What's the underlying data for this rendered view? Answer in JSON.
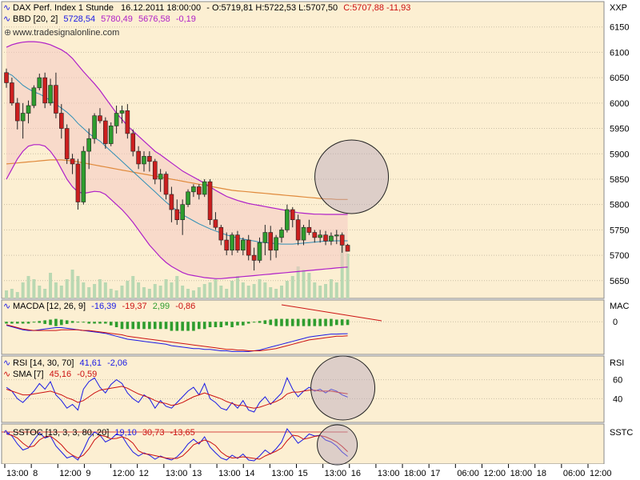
{
  "colors": {
    "background": "#fcefd2",
    "up": "#2e9d2e",
    "down": "#cc1f1f",
    "band": "#f4c9c2",
    "band_line": "#b020c8",
    "volume": "#b9d8b2",
    "macd": "#1a1ae6",
    "signal": "#cc1111",
    "rsi": "#1a1ae6",
    "sma": "#cc1111",
    "circle": "#b7a6bd"
  },
  "chart_data": [
    {
      "type": "candlestick",
      "panel": "price",
      "title_line": {
        "name": "DAX Perf. Index 1 Stunde",
        "stamp": "16.12.2011 18:00:00",
        "ohl": "- O:5719,81 H:5722,53 L:5707,50",
        "close": "C:5707,88 -11,93"
      },
      "indicator_line": {
        "name": "BBD [20, 2]",
        "v1": "5728,54",
        "v2": "5780,49",
        "v3": "5676,58",
        "v4": "-0,19"
      },
      "watermark": "www.tradesignalonline.com",
      "unit_label": "XXP",
      "ylim": [
        5615,
        6200
      ],
      "y_ticks": [
        "6150",
        "6100",
        "6050",
        "6000",
        "5950",
        "5900",
        "5850",
        "5800",
        "5750",
        "5700",
        "5650"
      ],
      "candles": [
        {
          "o": 6060,
          "h": 6068,
          "l": 6030,
          "c": 6040
        },
        {
          "o": 6040,
          "h": 6050,
          "l": 5995,
          "c": 6000
        },
        {
          "o": 6000,
          "h": 6010,
          "l": 5948,
          "c": 5965
        },
        {
          "o": 5965,
          "h": 6000,
          "l": 5930,
          "c": 5980
        },
        {
          "o": 5980,
          "h": 6005,
          "l": 5960,
          "c": 5995
        },
        {
          "o": 5995,
          "h": 6035,
          "l": 5990,
          "c": 6030
        },
        {
          "o": 6030,
          "h": 6058,
          "l": 6025,
          "c": 6050
        },
        {
          "o": 6050,
          "h": 6060,
          "l": 5990,
          "c": 6000
        },
        {
          "o": 6000,
          "h": 6048,
          "l": 5995,
          "c": 6035
        },
        {
          "o": 6035,
          "h": 6060,
          "l": 5970,
          "c": 5980
        },
        {
          "o": 5980,
          "h": 5998,
          "l": 5930,
          "c": 5950
        },
        {
          "o": 5950,
          "h": 5958,
          "l": 5880,
          "c": 5890
        },
        {
          "o": 5890,
          "h": 5900,
          "l": 5860,
          "c": 5880
        },
        {
          "o": 5880,
          "h": 5890,
          "l": 5790,
          "c": 5805
        },
        {
          "o": 5805,
          "h": 5915,
          "l": 5800,
          "c": 5905
        },
        {
          "o": 5905,
          "h": 5950,
          "l": 5870,
          "c": 5930
        },
        {
          "o": 5930,
          "h": 5980,
          "l": 5920,
          "c": 5975
        },
        {
          "o": 5975,
          "h": 5990,
          "l": 5960,
          "c": 5965
        },
        {
          "o": 5965,
          "h": 5972,
          "l": 5910,
          "c": 5920
        },
        {
          "o": 5920,
          "h": 5962,
          "l": 5915,
          "c": 5955
        },
        {
          "o": 5955,
          "h": 5995,
          "l": 5940,
          "c": 5980
        },
        {
          "o": 5980,
          "h": 5995,
          "l": 5960,
          "c": 5985
        },
        {
          "o": 5985,
          "h": 5998,
          "l": 5930,
          "c": 5940
        },
        {
          "o": 5940,
          "h": 5948,
          "l": 5895,
          "c": 5905
        },
        {
          "o": 5905,
          "h": 5915,
          "l": 5870,
          "c": 5880
        },
        {
          "o": 5880,
          "h": 5905,
          "l": 5865,
          "c": 5895
        },
        {
          "o": 5895,
          "h": 5905,
          "l": 5865,
          "c": 5885
        },
        {
          "o": 5885,
          "h": 5890,
          "l": 5840,
          "c": 5850
        },
        {
          "o": 5850,
          "h": 5870,
          "l": 5825,
          "c": 5860
        },
        {
          "o": 5860,
          "h": 5865,
          "l": 5810,
          "c": 5820
        },
        {
          "o": 5820,
          "h": 5835,
          "l": 5765,
          "c": 5790
        },
        {
          "o": 5790,
          "h": 5810,
          "l": 5760,
          "c": 5770
        },
        {
          "o": 5770,
          "h": 5810,
          "l": 5740,
          "c": 5800
        },
        {
          "o": 5800,
          "h": 5830,
          "l": 5795,
          "c": 5825
        },
        {
          "o": 5825,
          "h": 5840,
          "l": 5815,
          "c": 5835
        },
        {
          "o": 5835,
          "h": 5840,
          "l": 5810,
          "c": 5820
        },
        {
          "o": 5820,
          "h": 5850,
          "l": 5815,
          "c": 5845
        },
        {
          "o": 5845,
          "h": 5850,
          "l": 5760,
          "c": 5770
        },
        {
          "o": 5770,
          "h": 5785,
          "l": 5750,
          "c": 5755
        },
        {
          "o": 5755,
          "h": 5760,
          "l": 5720,
          "c": 5730
        },
        {
          "o": 5730,
          "h": 5745,
          "l": 5700,
          "c": 5710
        },
        {
          "o": 5710,
          "h": 5745,
          "l": 5700,
          "c": 5740
        },
        {
          "o": 5740,
          "h": 5748,
          "l": 5705,
          "c": 5710
        },
        {
          "o": 5710,
          "h": 5735,
          "l": 5700,
          "c": 5730
        },
        {
          "o": 5730,
          "h": 5740,
          "l": 5690,
          "c": 5700
        },
        {
          "o": 5700,
          "h": 5715,
          "l": 5670,
          "c": 5690
        },
        {
          "o": 5690,
          "h": 5735,
          "l": 5685,
          "c": 5725
        },
        {
          "o": 5725,
          "h": 5760,
          "l": 5700,
          "c": 5745
        },
        {
          "o": 5745,
          "h": 5758,
          "l": 5690,
          "c": 5710
        },
        {
          "o": 5710,
          "h": 5740,
          "l": 5695,
          "c": 5735
        },
        {
          "o": 5735,
          "h": 5755,
          "l": 5725,
          "c": 5750
        },
        {
          "o": 5750,
          "h": 5800,
          "l": 5745,
          "c": 5790
        },
        {
          "o": 5790,
          "h": 5795,
          "l": 5755,
          "c": 5770
        },
        {
          "o": 5770,
          "h": 5780,
          "l": 5720,
          "c": 5730
        },
        {
          "o": 5730,
          "h": 5760,
          "l": 5720,
          "c": 5755
        },
        {
          "o": 5755,
          "h": 5770,
          "l": 5740,
          "c": 5745
        },
        {
          "o": 5745,
          "h": 5750,
          "l": 5725,
          "c": 5735
        },
        {
          "o": 5735,
          "h": 5750,
          "l": 5725,
          "c": 5740
        },
        {
          "o": 5740,
          "h": 5748,
          "l": 5720,
          "c": 5728
        },
        {
          "o": 5728,
          "h": 5745,
          "l": 5720,
          "c": 5738
        },
        {
          "o": 5738,
          "h": 5750,
          "l": 5722,
          "c": 5740
        },
        {
          "o": 5740,
          "h": 5745,
          "l": 5705,
          "c": 5720
        },
        {
          "o": 5719.81,
          "h": 5722.53,
          "l": 5707.5,
          "c": 5707.88
        }
      ],
      "volume": [
        5,
        6,
        4,
        10,
        14,
        12,
        8,
        6,
        16,
        10,
        8,
        12,
        18,
        14,
        10,
        7,
        9,
        12,
        10,
        6,
        5,
        8,
        11,
        14,
        10,
        7,
        6,
        9,
        8,
        12,
        10,
        14,
        8,
        6,
        5,
        7,
        9,
        10,
        12,
        8,
        6,
        11,
        14,
        10,
        8,
        9,
        12,
        10,
        7,
        6,
        8,
        11,
        14,
        20,
        18,
        16,
        10,
        8,
        9,
        12,
        10,
        40,
        28
      ],
      "upper_band": [
        6110,
        6115,
        6118,
        6120,
        6121,
        6121,
        6120,
        6118,
        6115,
        6110,
        6105,
        6098,
        6088,
        6075,
        6062,
        6050,
        6038,
        6025,
        6010,
        5995,
        5980,
        5968,
        5955,
        5945,
        5935,
        5925,
        5915,
        5905,
        5898,
        5890,
        5882,
        5874,
        5866,
        5860,
        5854,
        5848,
        5842,
        5835,
        5828,
        5822,
        5816,
        5812,
        5808,
        5805,
        5802,
        5800,
        5798,
        5796,
        5794,
        5792,
        5790,
        5788,
        5786,
        5784,
        5783,
        5782,
        5781,
        5781,
        5780.6,
        5780.5,
        5780.5,
        5780.5,
        5780.49
      ],
      "lower_band": [
        5850,
        5870,
        5890,
        5905,
        5915,
        5918,
        5918,
        5915,
        5905,
        5890,
        5870,
        5850,
        5835,
        5825,
        5822,
        5824,
        5826,
        5825,
        5820,
        5810,
        5800,
        5790,
        5778,
        5765,
        5750,
        5735,
        5720,
        5708,
        5696,
        5686,
        5678,
        5672,
        5666,
        5662,
        5660,
        5658,
        5656,
        5655,
        5654,
        5654,
        5655,
        5656,
        5657,
        5658,
        5659,
        5660,
        5661,
        5662,
        5663,
        5664,
        5665,
        5666,
        5667,
        5668,
        5669,
        5670,
        5671,
        5672,
        5673,
        5674,
        5675,
        5676,
        5676.58
      ],
      "mid_band": [
        6060,
        6055,
        6045,
        6035,
        6028,
        6022,
        6018,
        6012,
        6005,
        5998,
        5990,
        5982,
        5972,
        5960,
        5950,
        5940,
        5932,
        5925,
        5915,
        5905,
        5895,
        5885,
        5875,
        5865,
        5855,
        5845,
        5835,
        5825,
        5815,
        5805,
        5796,
        5788,
        5780,
        5774,
        5768,
        5762,
        5757,
        5752,
        5748,
        5744,
        5740,
        5737,
        5734,
        5732,
        5730,
        5728,
        5726,
        5725,
        5724,
        5723,
        5722,
        5722,
        5722,
        5723,
        5724,
        5725,
        5726,
        5727,
        5728,
        5728,
        5728.5,
        5728.5,
        5728.54
      ],
      "ma_long": [
        5880,
        5881,
        5882,
        5883,
        5884,
        5885,
        5886,
        5887,
        5888,
        5888,
        5888,
        5887,
        5886,
        5884,
        5882,
        5880,
        5878,
        5876,
        5874,
        5872,
        5870,
        5868,
        5866,
        5864,
        5862,
        5860,
        5858,
        5856,
        5854,
        5852,
        5850,
        5848,
        5846,
        5844,
        5842,
        5840,
        5838,
        5836,
        5834,
        5832,
        5830,
        5828,
        5827,
        5826,
        5825,
        5824,
        5823,
        5822,
        5821,
        5820,
        5819,
        5818,
        5817,
        5816,
        5815,
        5814,
        5813,
        5812,
        5811,
        5811,
        5810,
        5810,
        5810
      ]
    },
    {
      "type": "line",
      "panel": "macd",
      "name": "MACDA [12, 26, 9]",
      "values_text": [
        "-16,39",
        "-19,37",
        "2,99",
        "-0,86"
      ],
      "unit_label": "MAC",
      "ylim": [
        -45,
        30
      ],
      "y_ticks": [
        "0"
      ],
      "macd": [
        -5,
        -7,
        -9,
        -11,
        -12,
        -12,
        -11,
        -10,
        -9,
        -8,
        -8,
        -9,
        -10,
        -11,
        -12,
        -13,
        -14,
        -15,
        -16,
        -18,
        -20,
        -22,
        -24,
        -25,
        -26,
        -27,
        -28,
        -29,
        -30,
        -31,
        -33,
        -34,
        -35,
        -36,
        -37,
        -37,
        -38,
        -38,
        -39,
        -40,
        -40,
        -41,
        -41,
        -41,
        -41,
        -40,
        -39,
        -37,
        -35,
        -33,
        -31,
        -29,
        -27,
        -25,
        -23,
        -21,
        -20,
        -19,
        -18,
        -17,
        -17,
        -16.5,
        -16.39
      ],
      "signal": [
        -4,
        -6,
        -8,
        -10,
        -11,
        -12,
        -12,
        -12,
        -12,
        -12,
        -11,
        -11,
        -11,
        -11,
        -12,
        -12,
        -13,
        -14,
        -15,
        -16,
        -17,
        -18,
        -20,
        -21,
        -22,
        -23,
        -24,
        -25,
        -26,
        -27,
        -28,
        -29,
        -30,
        -31,
        -32,
        -33,
        -34,
        -35,
        -36,
        -37,
        -38,
        -38,
        -39,
        -39,
        -40,
        -40,
        -40,
        -39,
        -38,
        -37,
        -35,
        -33,
        -31,
        -29,
        -27,
        -25,
        -24,
        -23,
        -22,
        -21,
        -20,
        -19.8,
        -19.37
      ],
      "histogram": [
        -1,
        -1,
        -1,
        -1,
        -1,
        0,
        1,
        2,
        3,
        4,
        3,
        2,
        1,
        0,
        0,
        -1,
        -1,
        -1,
        -1,
        -2,
        -3,
        -4,
        -4,
        -4,
        -4,
        -4,
        -4,
        -4,
        -4,
        -4,
        -5,
        -5,
        -5,
        -5,
        -5,
        -4,
        -4,
        -3,
        -3,
        -3,
        -2,
        -3,
        -2,
        -2,
        -1,
        0,
        1,
        2,
        3,
        4,
        4,
        4,
        4,
        4,
        4,
        4,
        4,
        4,
        4,
        4,
        3,
        3.3,
        2.99
      ]
    },
    {
      "type": "line",
      "panel": "rsi",
      "series_labels": [
        "RSI [14, 30, 70]",
        "SMA [7]"
      ],
      "rsi_values_text": [
        "41,61",
        "-2,06"
      ],
      "sma_values_text": [
        "45,16",
        "-0,59"
      ],
      "unit_label": "RSI",
      "ylim": [
        15,
        85
      ],
      "y_ticks": [
        "60",
        "40"
      ],
      "rsi": [
        52,
        48,
        40,
        36,
        42,
        48,
        56,
        50,
        58,
        44,
        38,
        30,
        34,
        28,
        50,
        58,
        62,
        52,
        46,
        55,
        60,
        56,
        46,
        40,
        36,
        44,
        40,
        30,
        38,
        32,
        30,
        36,
        42,
        48,
        52,
        44,
        56,
        40,
        36,
        30,
        28,
        36,
        30,
        38,
        28,
        26,
        36,
        42,
        34,
        40,
        46,
        62,
        50,
        42,
        48,
        52,
        48,
        50,
        46,
        50,
        48,
        44,
        41.61
      ],
      "sma": [
        50,
        48,
        46,
        44,
        44,
        45,
        46,
        47,
        48,
        46,
        44,
        41,
        39,
        36,
        38,
        42,
        46,
        49,
        50,
        51,
        52,
        53,
        51,
        48,
        45,
        43,
        41,
        38,
        36,
        35,
        33,
        34,
        36,
        39,
        42,
        44,
        46,
        44,
        42,
        40,
        37,
        35,
        33,
        33,
        31,
        30,
        31,
        33,
        35,
        37,
        40,
        45,
        47,
        47,
        48,
        49,
        49,
        48,
        48,
        48,
        47,
        46,
        45.16
      ]
    },
    {
      "type": "line",
      "panel": "sstoc",
      "name": "SSTOC [13, 3, 3, 80, 20]",
      "values_text": [
        "19,10",
        "30,73",
        "-13,65"
      ],
      "unit_label": "SSTC",
      "ylim": [
        0,
        100
      ],
      "k": [
        80,
        70,
        50,
        35,
        40,
        60,
        78,
        65,
        70,
        45,
        30,
        15,
        20,
        10,
        35,
        65,
        80,
        72,
        55,
        62,
        75,
        70,
        48,
        30,
        20,
        28,
        22,
        12,
        20,
        14,
        10,
        18,
        32,
        50,
        62,
        50,
        68,
        42,
        28,
        15,
        10,
        22,
        14,
        25,
        10,
        8,
        20,
        35,
        25,
        38,
        55,
        88,
        70,
        52,
        62,
        75,
        70,
        72,
        60,
        55,
        45,
        30,
        19.1
      ],
      "d": [
        75,
        72,
        65,
        52,
        42,
        45,
        60,
        68,
        70,
        60,
        48,
        32,
        22,
        15,
        22,
        38,
        60,
        72,
        69,
        63,
        64,
        68,
        63,
        52,
        33,
        26,
        24,
        21,
        18,
        15,
        14,
        14,
        20,
        33,
        48,
        54,
        60,
        55,
        46,
        30,
        20,
        15,
        16,
        18,
        16,
        14,
        12,
        20,
        26,
        32,
        40,
        58,
        72,
        70,
        62,
        65,
        69,
        71,
        68,
        62,
        55,
        44,
        30.73
      ],
      "hline": 80
    }
  ],
  "x_axis": {
    "labels": [
      "13:00",
      "8",
      "12:00",
      "9",
      "12:00",
      "12",
      "13:00",
      "13",
      "13:00",
      "14",
      "13:00",
      "15",
      "13:00",
      "16",
      "13:00",
      "18:00",
      "17",
      "06:00",
      "12:00",
      "18:00",
      "18",
      "06:00",
      "12:00"
    ]
  }
}
